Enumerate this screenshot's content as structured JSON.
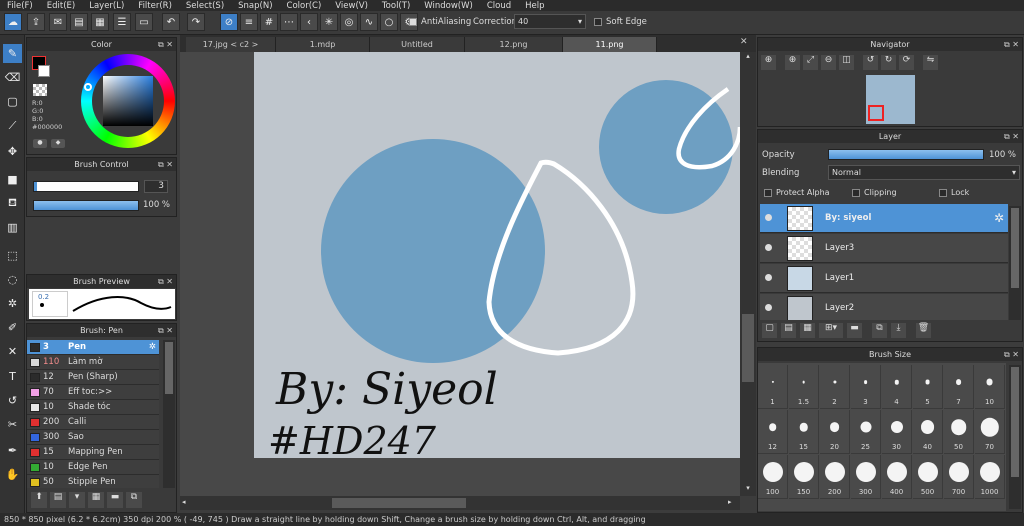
{
  "menu": [
    "File(F)",
    "Edit(E)",
    "Layer(L)",
    "Filter(R)",
    "Select(S)",
    "Snap(N)",
    "Color(C)",
    "View(V)",
    "Tool(T)",
    "Window(W)",
    "Cloud",
    "Help"
  ],
  "toolbar": {
    "antialiasing": "AntiAliasing",
    "correction_label": "Correction",
    "correction_value": "40",
    "soft_edge": "Soft Edge"
  },
  "color_panel": {
    "title": "Color",
    "r": "R:0",
    "g": "G:0",
    "b": "B:0",
    "hex": "#000000"
  },
  "brush_control": {
    "title": "Brush Control",
    "size": "3",
    "opacity": "100 %",
    "opacity_fraction": 1.0
  },
  "brush_preview": {
    "title": "Brush Preview",
    "size_label": "0.2"
  },
  "brush_list": {
    "title": "Brush: Pen",
    "items": [
      {
        "size": "3",
        "name": "Pen",
        "color": "#2b2b2b"
      },
      {
        "size": "110",
        "name": "Làm mờ",
        "color": "#d8d8d8"
      },
      {
        "size": "12",
        "name": "Pen (Sharp)",
        "color": "#2b2b2b"
      },
      {
        "size": "70",
        "name": "Eff toc:>>",
        "color": "#f2a0e6"
      },
      {
        "size": "10",
        "name": "Shade tóc",
        "color": "#e8e8e8"
      },
      {
        "size": "200",
        "name": "Calli",
        "color": "#e03030"
      },
      {
        "size": "300",
        "name": "Sao",
        "color": "#3366dd"
      },
      {
        "size": "15",
        "name": "Mapping Pen",
        "color": "#e03030"
      },
      {
        "size": "10",
        "name": "Edge Pen",
        "color": "#33aa33"
      },
      {
        "size": "50",
        "name": "Stipple Pen",
        "color": "#e0c020"
      }
    ]
  },
  "tabs": [
    "17.jpg < c2 >",
    "1.mdp",
    "Untitled",
    "12.png",
    "11.png"
  ],
  "canvas": {
    "signature_line1": "By: Siyeol",
    "signature_line2": "#HD247"
  },
  "navigator": {
    "title": "Navigator"
  },
  "layer_panel": {
    "title": "Layer",
    "opacity_label": "Opacity",
    "opacity_value": "100 %",
    "opacity_fraction": 1.0,
    "blending_label": "Blending",
    "blending_value": "Normal",
    "protect_alpha": "Protect Alpha",
    "clipping": "Clipping",
    "lock": "Lock",
    "layers": [
      "By: siyeol",
      "Layer3",
      "Layer1",
      "Layer2"
    ]
  },
  "brush_size": {
    "title": "Brush Size",
    "sizes": [
      "1",
      "1.5",
      "2",
      "3",
      "4",
      "5",
      "7",
      "10",
      "12",
      "15",
      "20",
      "25",
      "30",
      "40",
      "50",
      "70",
      "100",
      "150",
      "200",
      "300",
      "400",
      "500",
      "700",
      "1000"
    ]
  },
  "status": {
    "text": "850 * 850 pixel   (6.2 * 6.2cm)   350 dpi   200 %   ( -49, 745 )   Draw a straight line by holding down Shift, Change a brush size by holding down Ctrl, Alt, and dragging"
  },
  "colors": {
    "accent": "#4e93d6",
    "canvas_bg": "#bfc6cd",
    "circle": "#6e9fc2"
  }
}
